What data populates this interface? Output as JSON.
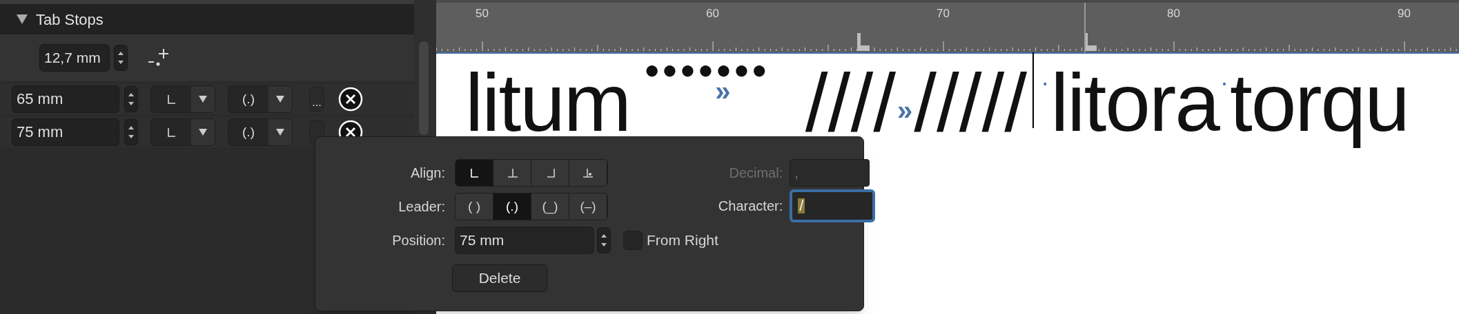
{
  "panel": {
    "title": "Tab Stops",
    "expanded": true,
    "default_spacing": "12,7 mm",
    "tab_stops": [
      {
        "position": "65 mm",
        "align": {
          "kind": "left"
        },
        "leader": "(.)",
        "more": "..."
      },
      {
        "position": "75 mm",
        "align": {
          "kind": "left"
        },
        "leader": "(.)"
      }
    ]
  },
  "ruler": {
    "labels": [
      "50",
      "60",
      "70",
      "80",
      "90"
    ]
  },
  "document": {
    "segments": [
      {
        "kind": "word",
        "text": "litum"
      },
      {
        "kind": "dots",
        "text": "●●●●●●●",
        "tab_mark": "»"
      },
      {
        "kind": "slashes",
        "text": "////",
        "tab_mark": "»",
        "text_after": "/////"
      },
      {
        "kind": "cursor"
      },
      {
        "kind": "space",
        "text": "·"
      },
      {
        "kind": "word",
        "text": "litora"
      },
      {
        "kind": "space",
        "text": "·"
      },
      {
        "kind": "word",
        "text": "torqu"
      }
    ]
  },
  "popup": {
    "align_label": "Align:",
    "align_options": [
      {
        "kind": "left",
        "selected": true
      },
      {
        "kind": "center",
        "selected": false
      },
      {
        "kind": "right",
        "selected": false
      },
      {
        "kind": "decimal",
        "selected": false
      }
    ],
    "leader_label": "Leader:",
    "leader_options": [
      {
        "label": "( )",
        "selected": false
      },
      {
        "label": "(.)",
        "selected": true
      },
      {
        "label": "(_)",
        "selected": false
      },
      {
        "label": "(–)",
        "selected": false
      }
    ],
    "position_label": "Position:",
    "position_value": "75 mm",
    "decimal_label": "Decimal:",
    "decimal_value": ",",
    "decimal_disabled": true,
    "character_label": "Character:",
    "character_value": "/",
    "character_focused": true,
    "from_right_label": "From Right",
    "from_right": false,
    "delete_label": "Delete"
  }
}
